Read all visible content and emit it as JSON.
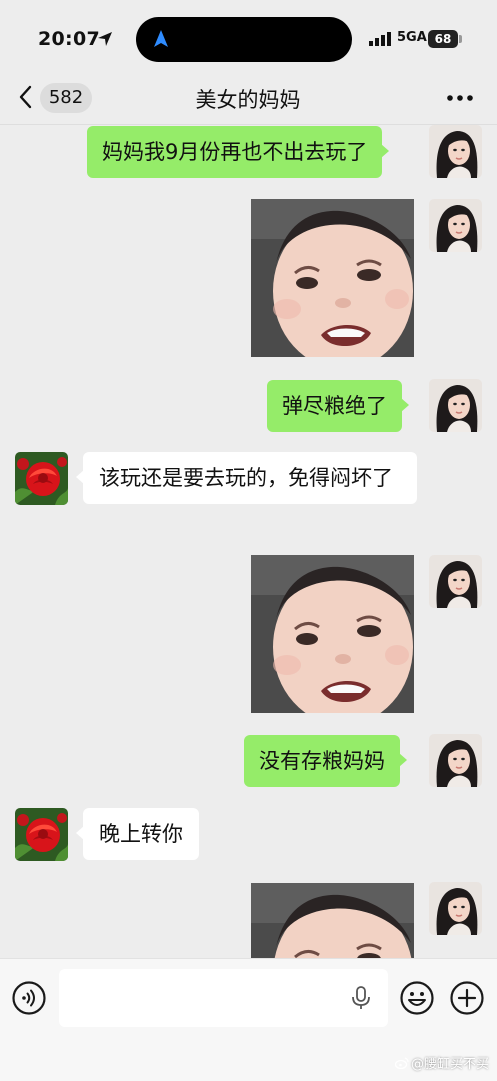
{
  "status_bar": {
    "time": "20:07",
    "network": "5GA",
    "battery": "68"
  },
  "header": {
    "back_count": "582",
    "title": "美女的妈妈"
  },
  "messages": [
    {
      "side": "out",
      "type": "text",
      "text": "妈妈我9月份再也不出去玩了"
    },
    {
      "side": "out",
      "type": "sticker",
      "sticker": "crying-baby"
    },
    {
      "side": "out",
      "type": "text",
      "text": "弹尽粮绝了"
    },
    {
      "side": "in",
      "type": "text",
      "text": "该玩还是要去玩的，免得闷坏了"
    },
    {
      "side": "out",
      "type": "sticker",
      "sticker": "crying-baby"
    },
    {
      "side": "out",
      "type": "text",
      "text": "没有存粮妈妈"
    },
    {
      "side": "in",
      "type": "text",
      "text": "晚上转你"
    },
    {
      "side": "out",
      "type": "sticker",
      "sticker": "crying-baby"
    }
  ],
  "input": {
    "value": "",
    "placeholder": ""
  },
  "watermark": "@腰缸买不买",
  "colors": {
    "outgoing_bubble": "#95ec69",
    "incoming_bubble": "#ffffff",
    "background": "#ededed"
  }
}
